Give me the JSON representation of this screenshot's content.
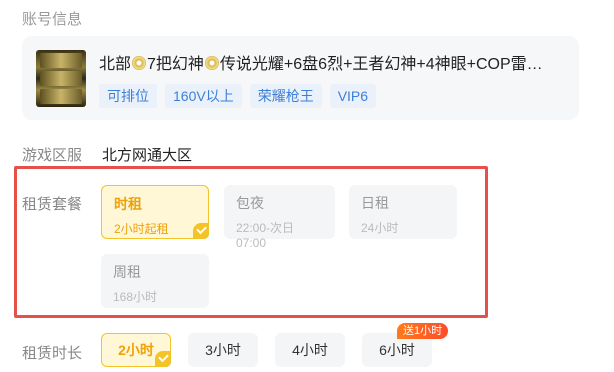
{
  "account_info": {
    "section_title": "账号信息",
    "title_parts": [
      "北部",
      "7把幻神",
      "传说光耀+6盘6烈+王者幻神+4神眼+COP雷…"
    ],
    "tags": [
      "可排位",
      "160V以上",
      "荣耀枪王",
      "VIP6"
    ]
  },
  "server": {
    "label": "游戏区服",
    "value": "北方网通大区"
  },
  "package": {
    "label": "租赁套餐",
    "options": [
      {
        "name": "时租",
        "sub": "2小时起租",
        "selected": true
      },
      {
        "name": "包夜",
        "sub": "22:00-次日07:00",
        "selected": false
      },
      {
        "name": "日租",
        "sub": "24小时",
        "selected": false
      },
      {
        "name": "周租",
        "sub": "168小时",
        "selected": false
      }
    ]
  },
  "duration": {
    "label": "租赁时长",
    "options": [
      "2小时",
      "3小时",
      "4小时",
      "6小时"
    ],
    "selected_index": 0,
    "promo_badge": "送1小时"
  },
  "colors": {
    "accent": "#f0a10a",
    "accent_border": "#f3c328",
    "tag_text": "#3d7fd6",
    "highlight_box": "#e5504a"
  }
}
